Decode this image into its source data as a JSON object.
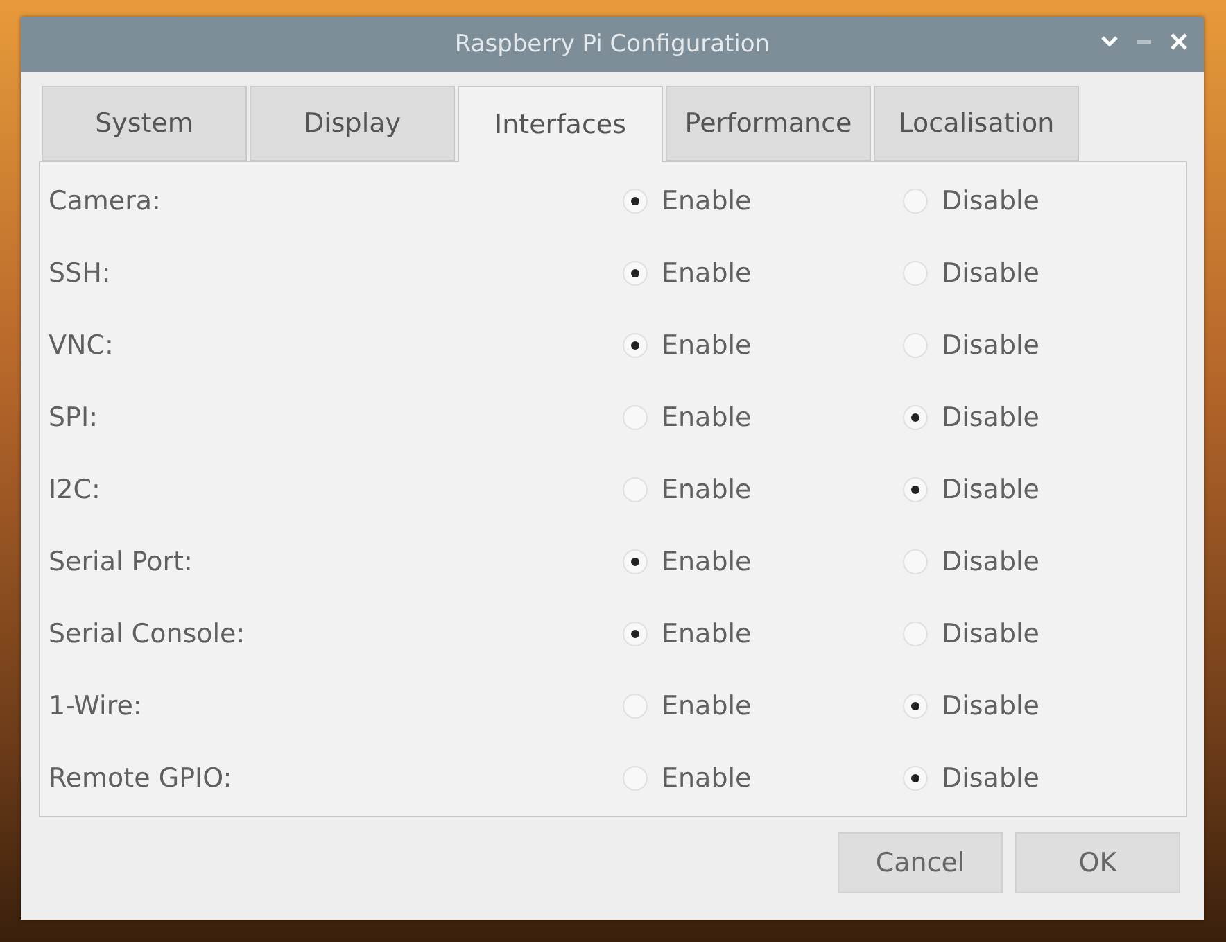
{
  "window": {
    "title": "Raspberry Pi Configuration"
  },
  "tabs": [
    {
      "label": "System",
      "selected": false
    },
    {
      "label": "Display",
      "selected": false
    },
    {
      "label": "Interfaces",
      "selected": true
    },
    {
      "label": "Performance",
      "selected": false
    },
    {
      "label": "Localisation",
      "selected": false
    }
  ],
  "rows": [
    {
      "label": "Camera:",
      "options": [
        {
          "label": "Enable",
          "selected": true
        },
        {
          "label": "Disable",
          "selected": false
        }
      ]
    },
    {
      "label": "SSH:",
      "options": [
        {
          "label": "Enable",
          "selected": true
        },
        {
          "label": "Disable",
          "selected": false
        }
      ]
    },
    {
      "label": "VNC:",
      "options": [
        {
          "label": "Enable",
          "selected": true
        },
        {
          "label": "Disable",
          "selected": false
        }
      ]
    },
    {
      "label": "SPI:",
      "options": [
        {
          "label": "Enable",
          "selected": false
        },
        {
          "label": "Disable",
          "selected": true
        }
      ]
    },
    {
      "label": "I2C:",
      "options": [
        {
          "label": "Enable",
          "selected": false
        },
        {
          "label": "Disable",
          "selected": true
        }
      ]
    },
    {
      "label": "Serial Port:",
      "options": [
        {
          "label": "Enable",
          "selected": true
        },
        {
          "label": "Disable",
          "selected": false
        }
      ]
    },
    {
      "label": "Serial Console:",
      "options": [
        {
          "label": "Enable",
          "selected": true
        },
        {
          "label": "Disable",
          "selected": false
        }
      ]
    },
    {
      "label": "1-Wire:",
      "options": [
        {
          "label": "Enable",
          "selected": false
        },
        {
          "label": "Disable",
          "selected": true
        }
      ]
    },
    {
      "label": "Remote GPIO:",
      "options": [
        {
          "label": "Enable",
          "selected": false
        },
        {
          "label": "Disable",
          "selected": true
        }
      ]
    }
  ],
  "buttons": [
    "Cancel",
    "OK"
  ]
}
